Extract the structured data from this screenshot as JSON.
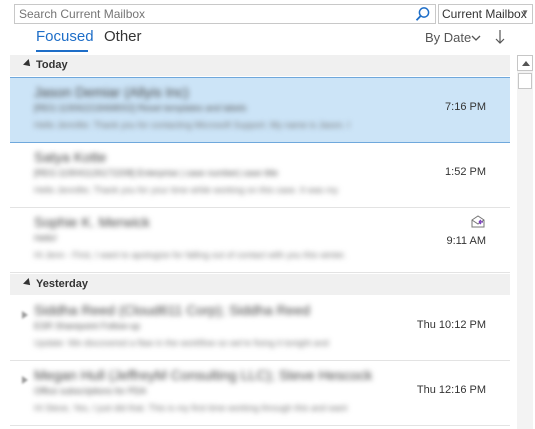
{
  "search": {
    "placeholder": "Search Current Mailbox",
    "scope_label": "Current Mailbox",
    "icon": "search-icon"
  },
  "tabs": [
    {
      "label": "Focused",
      "active": true
    },
    {
      "label": "Other",
      "active": false
    }
  ],
  "sort": {
    "label": "By Date",
    "chevron_icon": "chevron-down-icon",
    "direction_icon": "arrow-down-icon"
  },
  "colors": {
    "accent": "#1e6ec8",
    "selected_bg": "#cce4f7",
    "selected_border": "#6fa8dc",
    "group_bg": "#f0f0f0"
  },
  "groups": [
    {
      "label": "Today",
      "messages": [
        {
          "sender": "Jason Demiar (Allyis Inc)",
          "subject": "[REG:119062218468002] Reset templates and labels",
          "preview": "Hello Jennifer. Thank you for contacting Microsoft Support. My name is Jason. I",
          "time": "7:16 PM",
          "selected": true
        },
        {
          "sender": "Satya Kotte",
          "subject": "[REG:119041126172208] Enterprise | case number| case title",
          "preview": "Hello Jennifer,   Thank you for your time while working on this case. It was my",
          "time": "1:52 PM",
          "selected": false
        },
        {
          "sender": "Sophie K. Merwick",
          "subject": "Hello!",
          "preview": "Hi Jenn -   First, I want to apologize for falling out of contact with you this winter.",
          "time": "9:11 AM",
          "selected": false,
          "replied": true
        }
      ]
    },
    {
      "label": "Yesterday",
      "messages": [
        {
          "sender": "Siddha Reed (Cloud611 Corp);  Siddha Reed",
          "subject": "ESR Sharepoint Follow-up",
          "preview": "Update: We discovered a flaw in the workflow so we're fixing it tonight and",
          "time": "Thu 10:12 PM",
          "selected": false,
          "thread": true
        },
        {
          "sender": "Megan Hull (JeffreyM Consulting LLC);  Steve Hescock",
          "subject": "Office subscriptions for PDA",
          "preview": "Hi Steve,  Yes, I just did that. This is my first time working through this and want",
          "time": "Thu 12:16 PM",
          "selected": false,
          "thread": true
        }
      ]
    }
  ]
}
